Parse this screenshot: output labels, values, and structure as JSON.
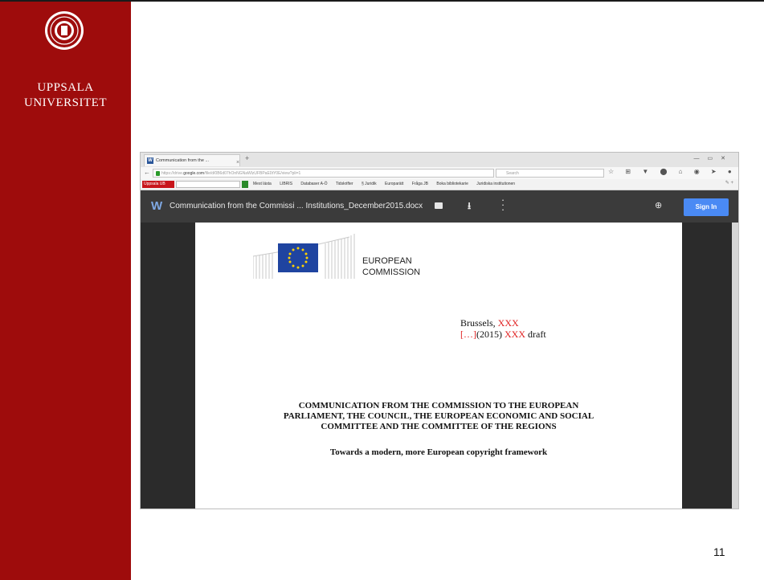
{
  "slide": {
    "university_line1": "UPPSALA",
    "university_line2": "UNIVERSITET",
    "page_number": "11",
    "brand_red": "#9e0c0c"
  },
  "browser": {
    "tab_title": "Communication from the ...",
    "tab_close": "×",
    "new_tab": "+",
    "url_prefix": "https://drive.",
    "url_domain": "google.com",
    "url_rest": "/file/d/0B6d07hOnNGNaWlzUFBPaE0tY0E/view?pli=1",
    "search_placeholder": "Search",
    "toolbar_icons": "☆ ⊞ ▼ ⬤ ⌂ ◉ ➤ ● ≡ ⊡",
    "bookmarks": {
      "uu_button": "Uppsala UB",
      "items": [
        "Mest lästa",
        "LIBRIS",
        "Databaser A-Ö",
        "Tidskrifter",
        "§ Juridik",
        "Europarätt",
        "Fråga JB",
        "Boka bibliotekarie",
        "Juridiska institutionen"
      ]
    }
  },
  "viewer": {
    "file_title": "Communication from the Commissi ... Institutions_December2015.docx",
    "sign_in": "Sign In",
    "accent": "#4a8af4"
  },
  "document": {
    "ec_line1": "EUROPEAN",
    "ec_line2": "COMMISSION",
    "brussels_label": "Brussels, ",
    "brussels_xxx": "XXX",
    "draft_bracket": "[…]",
    "draft_year": "(2015) ",
    "draft_xxx": "XXX",
    "draft_word": " draft",
    "comm_line1": "COMMUNICATION FROM THE COMMISSION TO THE EUROPEAN",
    "comm_line2": "PARLIAMENT, THE COUNCIL, THE EUROPEAN ECONOMIC AND SOCIAL",
    "comm_line3": "COMMITTEE AND THE COMMITTEE OF THE REGIONS",
    "subtitle": "Towards a modern, more European copyright framework"
  }
}
